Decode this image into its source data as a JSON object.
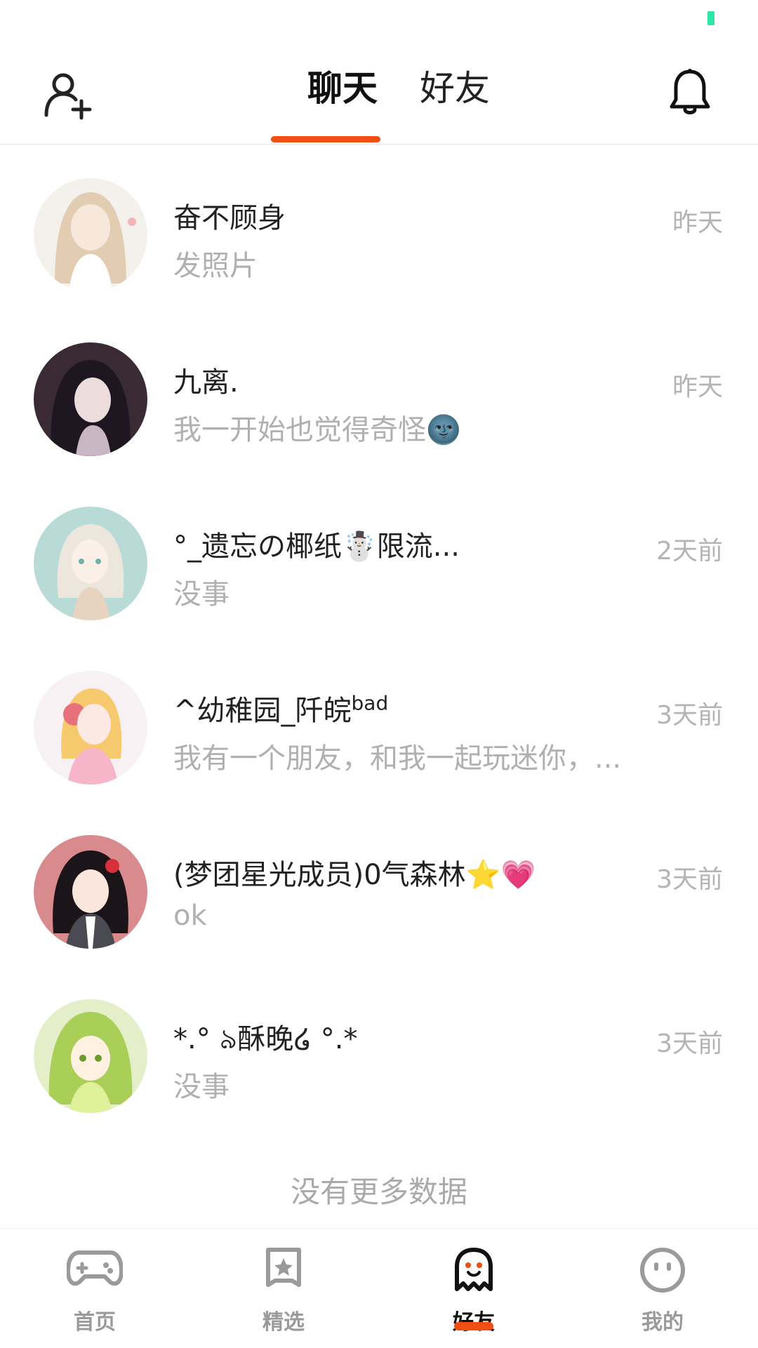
{
  "header": {
    "tabs": [
      {
        "label": "聊天",
        "active": true
      },
      {
        "label": "好友",
        "active": false
      }
    ],
    "add_friend_icon": "add-user-icon",
    "notification_icon": "bell-icon"
  },
  "chats": [
    {
      "name": "奋不顾身",
      "message": "发照片",
      "time": "昨天"
    },
    {
      "name": "九离.",
      "message": "我一开始也觉得奇怪🌚",
      "time": "昨天"
    },
    {
      "name": "°_遗忘の椰纸☃️限流...",
      "message": "没事",
      "time": "2天前"
    },
    {
      "name": "^幼稚园_阡皖",
      "name_sup": "bad",
      "message": "我有一个朋友，和我一起玩迷你，...",
      "time": "3天前"
    },
    {
      "name": "(梦团星光成员)0气森林⭐💗",
      "message": "ok",
      "time": "3天前"
    },
    {
      "name": "*.° ৯酥晚໒ °.*",
      "message": "没事",
      "time": "3天前"
    }
  ],
  "footer_text": "没有更多数据",
  "bottom_nav": [
    {
      "label": "首页",
      "icon": "gamepad-icon",
      "active": false
    },
    {
      "label": "精选",
      "icon": "star-bookmark-icon",
      "active": false
    },
    {
      "label": "好友",
      "icon": "ghost-icon",
      "active": true
    },
    {
      "label": "我的",
      "icon": "face-icon",
      "active": false
    }
  ],
  "colors": {
    "accent": "#ef4f12",
    "status_battery": "#2ee6a6"
  }
}
